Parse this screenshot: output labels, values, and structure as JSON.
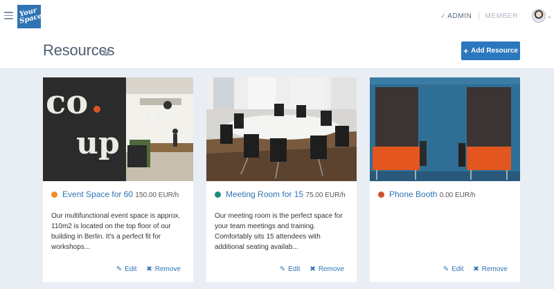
{
  "app": {
    "logo_text_1": "Your",
    "logo_text_2": "Space"
  },
  "topbar": {
    "role_admin": "ADMIN",
    "role_member": "MEMBER"
  },
  "header": {
    "title": "Resources",
    "add_button": "Add Resource"
  },
  "cards": [
    {
      "name": "Event Space for 60",
      "price": "150.00 EUR/h",
      "dot_color": "#f28a2b",
      "description": "Our multifunctional event space is approx. 110m2 is located on the top floor of our building in Berlin. It's a perfect fit for workshops...",
      "edit": "Edit",
      "remove": "Remove"
    },
    {
      "name": "Meeting Room for 15",
      "price": "75.00 EUR/h",
      "dot_color": "#1f8a7d",
      "description": "Our meeting room is the perfect space for your team meetings and training. Comfortably sits 15 attendees with additional seating availab...",
      "edit": "Edit",
      "remove": "Remove"
    },
    {
      "name": "Phone Booth",
      "price": "0.00 EUR/h",
      "dot_color": "#c8532e",
      "description": "",
      "edit": "Edit",
      "remove": "Remove"
    }
  ],
  "colors": {
    "accent": "#2b77be",
    "page_bg": "#e9eef5"
  },
  "icons": [
    "menu-icon",
    "check-icon",
    "help-icon",
    "plus-icon",
    "pencil-icon",
    "close-icon",
    "chevron-down-icon"
  ]
}
